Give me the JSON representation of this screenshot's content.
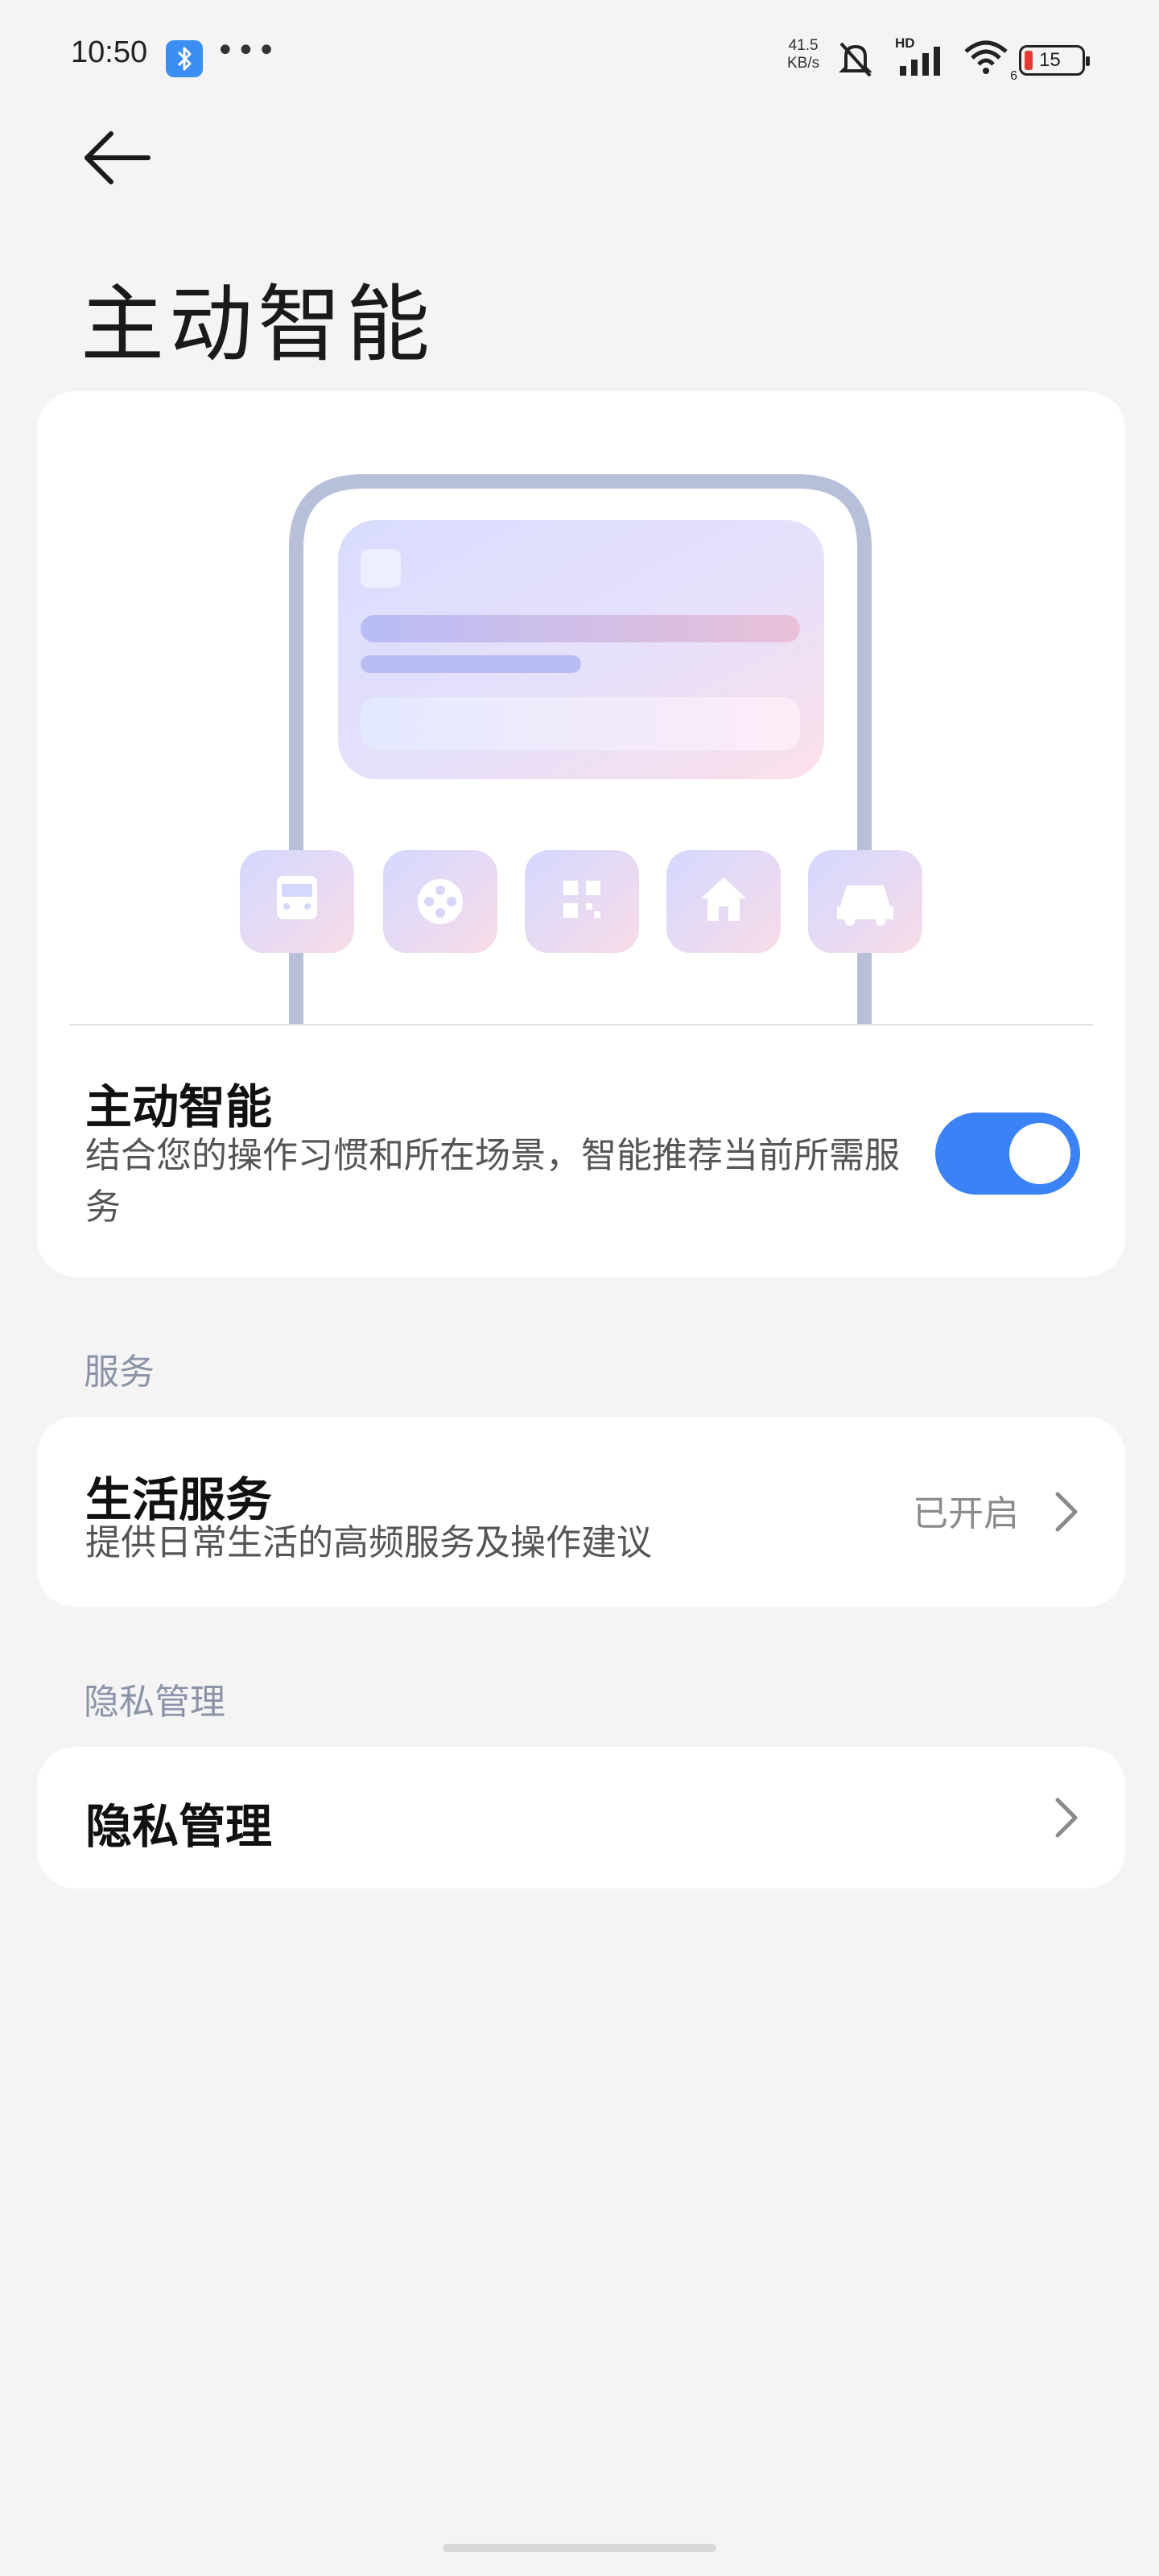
{
  "status_bar": {
    "time": "10:50",
    "network_speed_value": "41.5",
    "network_speed_unit": "KB/s",
    "hd_label": "HD",
    "wifi_sub": "6",
    "battery_level": "15",
    "more_dots": "•••"
  },
  "header": {
    "title": "主动智能"
  },
  "main_card": {
    "toggle_title": "主动智能",
    "toggle_description": "结合您的操作习惯和所在场景，智能推荐当前所需服务",
    "toggle_on": true,
    "illustration_icons": [
      "bus-icon",
      "film-reel-icon",
      "qr-code-icon",
      "home-icon",
      "car-icon"
    ]
  },
  "services_section": {
    "label": "服务",
    "life_service": {
      "title": "生活服务",
      "description": "提供日常生活的高频服务及操作建议",
      "status": "已开启"
    }
  },
  "privacy_section": {
    "label": "隐私管理",
    "item_title": "隐私管理"
  },
  "colors": {
    "accent": "#3b82f6",
    "background": "#f4f4f4",
    "section_label": "#8a93a8"
  }
}
